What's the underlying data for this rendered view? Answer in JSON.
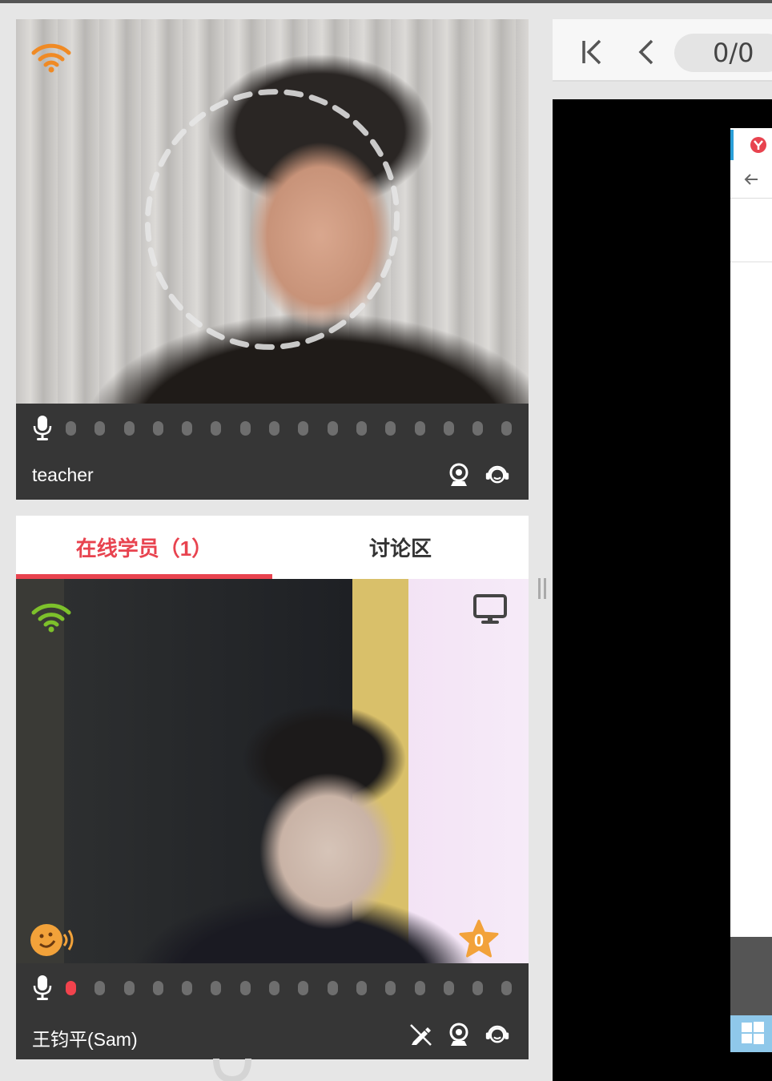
{
  "teacher": {
    "name": "teacher",
    "network_signal": "good",
    "colors": {
      "wifi": "#f08a24"
    }
  },
  "tabs": [
    {
      "label": "在线学员（1）",
      "active": true
    },
    {
      "label": "讨论区",
      "active": false
    }
  ],
  "student": {
    "name": "王钧平(Sam)",
    "star_count": "0",
    "colors": {
      "wifi": "#7dc12b",
      "star": "#f2a23a",
      "mic_level": "#f2434d"
    },
    "mic_level_dots_active": 1
  },
  "pager": {
    "page_display": "0/0"
  },
  "icons": {
    "mic": "microphone-icon",
    "camera": "webcam-icon",
    "headset": "headset-icon",
    "pen": "pen-disabled-icon",
    "monitor": "monitor-icon",
    "first": "first-page-icon",
    "prev": "prev-page-icon"
  },
  "colors": {
    "accent": "#e8434f",
    "bar_bg": "#363636",
    "stage_bg": "#000000"
  }
}
